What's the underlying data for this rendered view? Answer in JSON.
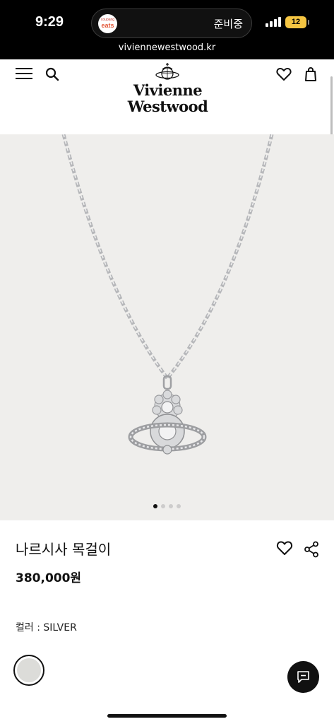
{
  "status_bar": {
    "time": "9:29",
    "island_app_top": "coupang",
    "island_app_name": "eats",
    "island_status": "준비중",
    "battery": "12",
    "url": "viviennewestwood.kr"
  },
  "header": {
    "logo_line1": "Vivienne",
    "logo_line2": "Westwood",
    "icons": [
      "menu-icon",
      "search-icon",
      "heart-icon",
      "shopping-bag-icon"
    ]
  },
  "gallery": {
    "total_slides": 4,
    "active_slide": 1
  },
  "product": {
    "name": "나르시사 목걸이",
    "price": "380,000원",
    "color_label": "컬러 : ",
    "color_value": "SILVER"
  },
  "colors": {
    "accent": "#111111",
    "hero_background": "#efeeec",
    "swatch_silver": "#dcdcd9"
  }
}
